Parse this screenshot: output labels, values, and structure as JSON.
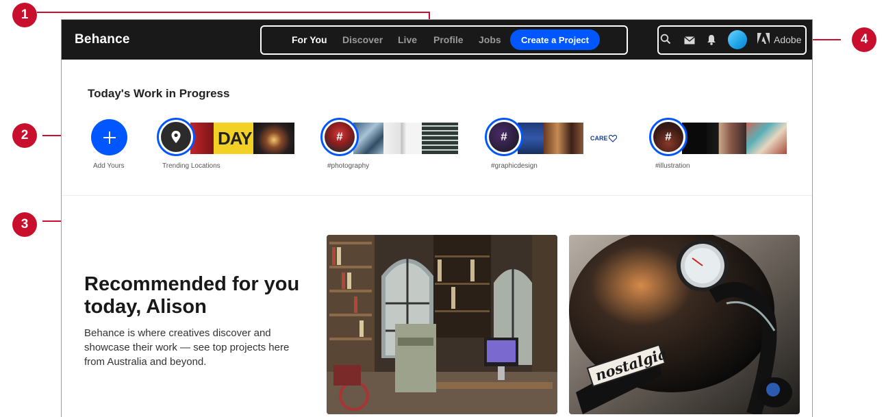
{
  "header": {
    "logo": "Behance",
    "nav": [
      "For You",
      "Discover",
      "Live",
      "Profile",
      "Jobs"
    ],
    "active_nav": "For You",
    "create_button": "Create a Project",
    "icons": [
      "search-icon",
      "mail-icon",
      "bell-icon",
      "avatar",
      "adobe-icon"
    ],
    "adobe_label": "Adobe"
  },
  "wip": {
    "title": "Today's Work in Progress",
    "add_label": "Add Yours",
    "items": [
      {
        "label": "Trending Locations",
        "icon": "location-pin-icon"
      },
      {
        "label": "#photography",
        "icon": "#"
      },
      {
        "label": "#graphicdesign",
        "icon": "#"
      },
      {
        "label": "#illustration",
        "icon": "#"
      }
    ],
    "thumb_texts": {
      "day": "DAY",
      "care": "CARE"
    }
  },
  "recommended": {
    "title": "Recommended for you today, Alison",
    "description": "Behance is where creatives discover and showcase their work — see top projects here from Australia and beyond.",
    "card_caption": "nostalgia"
  },
  "callouts": [
    "1",
    "2",
    "3",
    "4"
  ],
  "colors": {
    "accent": "#0057ff",
    "callout": "#c8102e",
    "topbar": "#191919"
  }
}
